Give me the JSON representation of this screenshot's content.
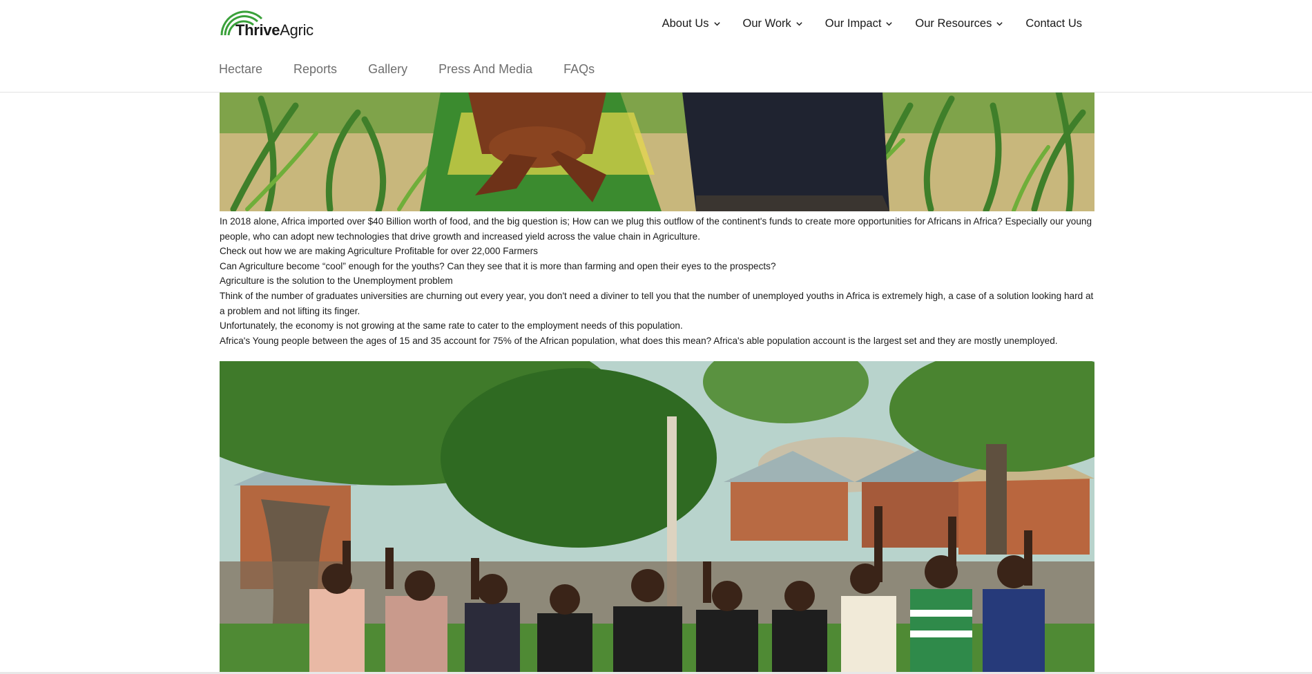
{
  "brand": {
    "name_bold": "Thrive",
    "name_regular": "Agric",
    "accent_color": "#3aa13a"
  },
  "main_nav": [
    {
      "label": "About Us",
      "has_dropdown": true
    },
    {
      "label": "Our Work",
      "has_dropdown": true
    },
    {
      "label": "Our Impact",
      "has_dropdown": true
    },
    {
      "label": "Our Resources",
      "has_dropdown": true
    },
    {
      "label": "Contact Us",
      "has_dropdown": false
    }
  ],
  "sub_nav": [
    "Hectare",
    "Reports",
    "Gallery",
    "Press And Media",
    "FAQs"
  ],
  "article": {
    "paragraphs": [
      "In 2018 alone, Africa imported over $40 Billion worth of food, and the big question is; How can we plug this outflow of the continent's funds to create more opportunities for Africans in Africa? Especially our young people, who can adopt new technologies that drive growth and increased yield across the value chain in Agriculture.",
      "Check out how we are making Agriculture Profitable for over 22,000 Farmers",
      "Can Agriculture become “cool” enough for the youths? Can they see that it is more than farming and open their eyes to the prospects?",
      "Agriculture is the solution to the Unemployment problem",
      "Think of the number of graduates universities are churning out every year, you don't need a diviner to tell you that the number of unemployed youths in Africa is extremely high, a case of a solution looking hard at a problem and not lifting its finger.",
      "Unfortunately, the economy is not growing at the same rate to cater to the employment needs of this population.",
      "Africa's Young people between the ages of 15 and 35 account for 75% of the African population, what does this mean? Africa's able population account is the largest set and they are mostly unemployed."
    ]
  },
  "images": {
    "top": "farmers-in-maize-field-photo",
    "bottom": "youth-group-celebrating-in-village-photo"
  }
}
